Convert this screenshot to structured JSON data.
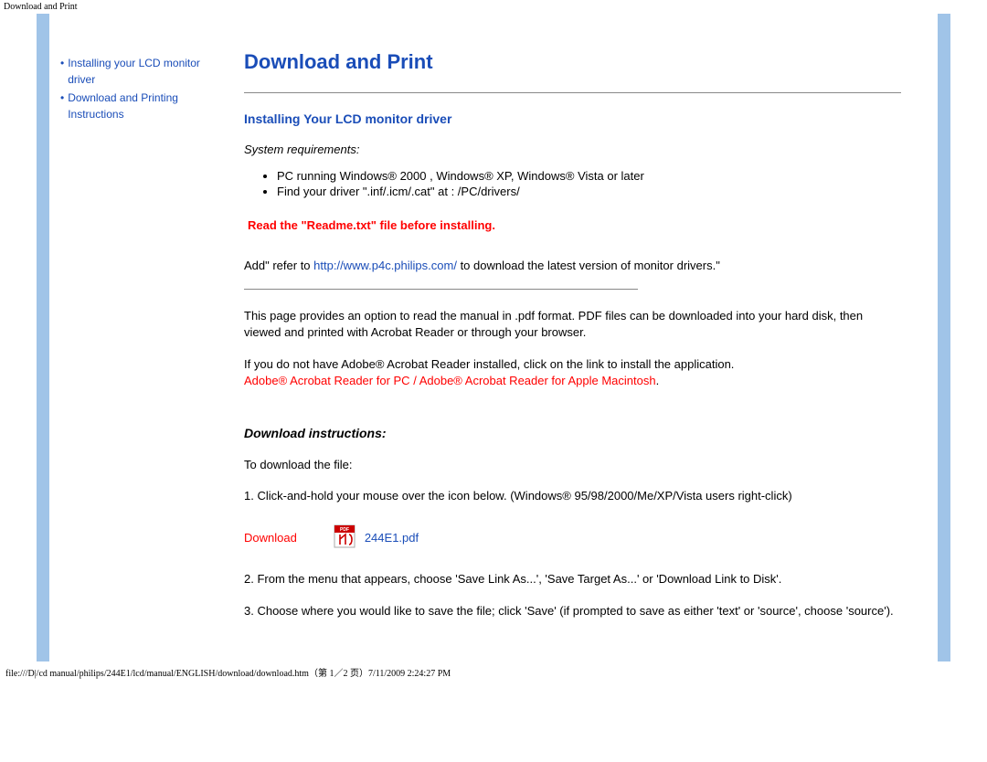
{
  "header_small": "Download and Print",
  "sidebar": {
    "items": [
      {
        "label": "Installing your LCD monitor driver"
      },
      {
        "label": "Download and Printing Instructions"
      }
    ]
  },
  "title": "Download and Print",
  "section1": {
    "heading": "Installing Your LCD monitor driver",
    "sysreq_label": "System requirements:",
    "sysreq_items": [
      "PC running Windows® 2000 , Windows® XP, Windows® Vista or later",
      "Find your driver \".inf/.icm/.cat\" at : /PC/drivers/"
    ],
    "warn": "Read the \"Readme.txt\" file before installing.",
    "refer_prefix": "Add\" refer to ",
    "refer_link": "http://www.p4c.philips.com/",
    "refer_suffix": " to download the latest version of monitor drivers.\""
  },
  "section2": {
    "para1": "This page provides an option to read the manual in .pdf format. PDF files can be downloaded into your hard disk, then viewed and printed with Acrobat Reader or through your browser.",
    "para2_prefix": "If you do not have Adobe® Acrobat Reader installed, click on the link to install the application.",
    "acro_pc": "Adobe® Acrobat Reader for PC",
    "sep": " / ",
    "acro_mac": "Adobe® Acrobat Reader for Apple Macintosh",
    "tail": "."
  },
  "download": {
    "heading": "Download instructions:",
    "line1": "To download the file:",
    "step1": "1. Click-and-hold your mouse over the icon below. (Windows® 95/98/2000/Me/XP/Vista users right-click)",
    "label": "Download",
    "file": "244E1.pdf",
    "step2": "2. From the menu that appears, choose 'Save Link As...', 'Save Target As...' or 'Download Link to Disk'.",
    "step3": "3. Choose where you would like to save the file; click 'Save' (if prompted to save as either 'text' or 'source', choose 'source')."
  },
  "footer": "file:///D|/cd manual/philips/244E1/lcd/manual/ENGLISH/download/download.htm（第 1／2 页）7/11/2009 2:24:27 PM"
}
